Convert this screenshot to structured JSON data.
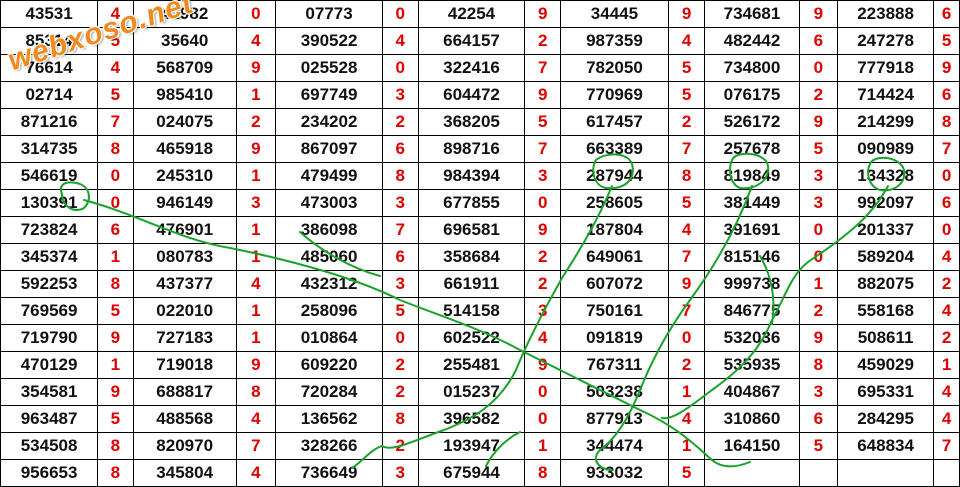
{
  "watermark": {
    "text": "webxoso.net"
  },
  "colors": {
    "number": "#111111",
    "digit": "#e00000",
    "pen": "#1aa32a",
    "logo": "#f08a1c"
  },
  "rows": [
    [
      [
        "43531",
        "4"
      ],
      [
        "42982",
        "0"
      ],
      [
        "07773",
        "0"
      ],
      [
        "42254",
        "9"
      ],
      [
        "34445",
        "9"
      ],
      [
        "734681",
        "9"
      ],
      [
        "223888",
        "6"
      ]
    ],
    [
      [
        "85314",
        "5"
      ],
      [
        "35640",
        "4"
      ],
      [
        "390522",
        "4"
      ],
      [
        "664157",
        "2"
      ],
      [
        "987359",
        "4"
      ],
      [
        "482442",
        "6"
      ],
      [
        "247278",
        "5"
      ]
    ],
    [
      [
        "76614",
        "4"
      ],
      [
        "568709",
        "9"
      ],
      [
        "025528",
        "0"
      ],
      [
        "322416",
        "7"
      ],
      [
        "782050",
        "5"
      ],
      [
        "734800",
        "0"
      ],
      [
        "777918",
        "9"
      ]
    ],
    [
      [
        "02714",
        "5"
      ],
      [
        "985410",
        "1"
      ],
      [
        "697749",
        "3"
      ],
      [
        "604472",
        "9"
      ],
      [
        "770969",
        "5"
      ],
      [
        "076175",
        "2"
      ],
      [
        "714424",
        "6"
      ]
    ],
    [
      [
        "871216",
        "7"
      ],
      [
        "024075",
        "2"
      ],
      [
        "234202",
        "2"
      ],
      [
        "368205",
        "5"
      ],
      [
        "617457",
        "2"
      ],
      [
        "526172",
        "9"
      ],
      [
        "214299",
        "8"
      ]
    ],
    [
      [
        "314735",
        "8"
      ],
      [
        "465918",
        "9"
      ],
      [
        "867097",
        "6"
      ],
      [
        "898716",
        "7"
      ],
      [
        "663389",
        "7"
      ],
      [
        "257678",
        "5"
      ],
      [
        "090989",
        "7"
      ]
    ],
    [
      [
        "546619",
        "0"
      ],
      [
        "245310",
        "1"
      ],
      [
        "479499",
        "8"
      ],
      [
        "984394",
        "3"
      ],
      [
        "287944",
        "8"
      ],
      [
        "819849",
        "3"
      ],
      [
        "134328",
        "0"
      ]
    ],
    [
      [
        "130391",
        "0"
      ],
      [
        "946149",
        "3"
      ],
      [
        "473003",
        "3"
      ],
      [
        "677855",
        "0"
      ],
      [
        "258605",
        "5"
      ],
      [
        "381449",
        "3"
      ],
      [
        "992097",
        "6"
      ]
    ],
    [
      [
        "723824",
        "6"
      ],
      [
        "476901",
        "1"
      ],
      [
        "386098",
        "7"
      ],
      [
        "696581",
        "9"
      ],
      [
        "187804",
        "4"
      ],
      [
        "391691",
        "0"
      ],
      [
        "201337",
        "0"
      ]
    ],
    [
      [
        "345374",
        "1"
      ],
      [
        "080783",
        "1"
      ],
      [
        "485060",
        "6"
      ],
      [
        "358684",
        "2"
      ],
      [
        "649061",
        "7"
      ],
      [
        "815146",
        "0"
      ],
      [
        "589204",
        "4"
      ]
    ],
    [
      [
        "592253",
        "8"
      ],
      [
        "437377",
        "4"
      ],
      [
        "432312",
        "3"
      ],
      [
        "661911",
        "2"
      ],
      [
        "607072",
        "9"
      ],
      [
        "999738",
        "1"
      ],
      [
        "882075",
        "2"
      ]
    ],
    [
      [
        "769569",
        "5"
      ],
      [
        "022010",
        "1"
      ],
      [
        "258096",
        "5"
      ],
      [
        "514158",
        "3"
      ],
      [
        "750161",
        "7"
      ],
      [
        "846775",
        "2"
      ],
      [
        "558168",
        "4"
      ]
    ],
    [
      [
        "719790",
        "9"
      ],
      [
        "727183",
        "1"
      ],
      [
        "010864",
        "0"
      ],
      [
        "602522",
        "4"
      ],
      [
        "091819",
        "0"
      ],
      [
        "532036",
        "9"
      ],
      [
        "508611",
        "2"
      ]
    ],
    [
      [
        "470129",
        "1"
      ],
      [
        "719018",
        "9"
      ],
      [
        "609220",
        "2"
      ],
      [
        "255481",
        "9"
      ],
      [
        "767311",
        "2"
      ],
      [
        "535935",
        "8"
      ],
      [
        "459029",
        "1"
      ]
    ],
    [
      [
        "354581",
        "9"
      ],
      [
        "688817",
        "8"
      ],
      [
        "720284",
        "2"
      ],
      [
        "015237",
        "0"
      ],
      [
        "503238",
        "1"
      ],
      [
        "404867",
        "3"
      ],
      [
        "695331",
        "4"
      ]
    ],
    [
      [
        "963487",
        "5"
      ],
      [
        "488568",
        "4"
      ],
      [
        "136562",
        "8"
      ],
      [
        "396582",
        "0"
      ],
      [
        "877913",
        "4"
      ],
      [
        "310860",
        "6"
      ],
      [
        "284295",
        "4"
      ]
    ],
    [
      [
        "534508",
        "8"
      ],
      [
        "820970",
        "7"
      ],
      [
        "328266",
        "2"
      ],
      [
        "193947",
        "1"
      ],
      [
        "344474",
        "1"
      ],
      [
        "164150",
        "5"
      ],
      [
        "648834",
        "7"
      ]
    ],
    [
      [
        "956653",
        "8"
      ],
      [
        "345804",
        "4"
      ],
      [
        "736649",
        "3"
      ],
      [
        "675944",
        "8"
      ],
      [
        "933032",
        "5"
      ],
      [
        "",
        ""
      ],
      [
        "",
        ""
      ]
    ]
  ]
}
